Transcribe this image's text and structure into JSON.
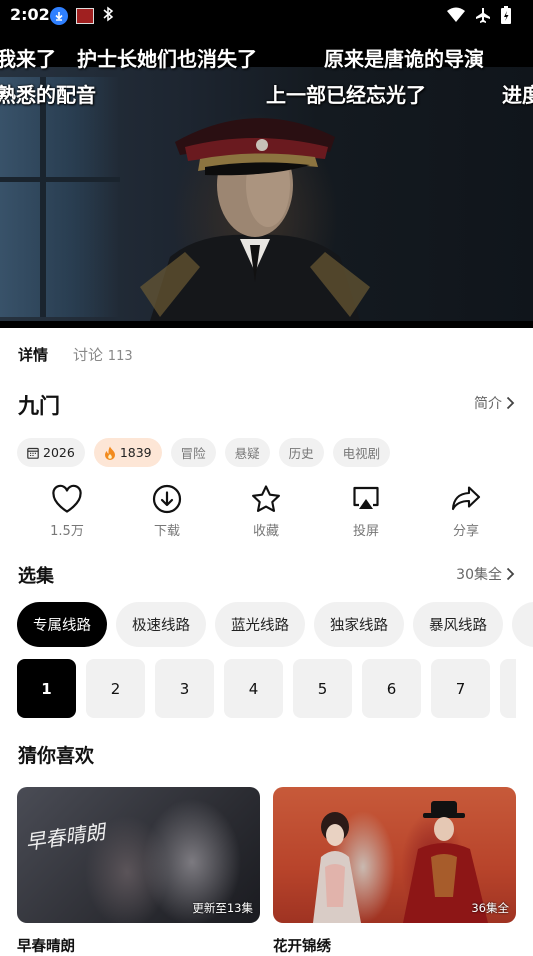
{
  "status_bar": {
    "time": "2:02",
    "icons": [
      "download-notification-icon",
      "app-notification-icon",
      "bluetooth-icon",
      "wifi-icon",
      "airplane-mode-icon",
      "battery-charging-icon"
    ]
  },
  "player": {
    "danmaku": [
      "我来了",
      "护士长她们也消失了",
      "原来是唐诡的导演",
      "熟悉的配音",
      "上一部已经忘光了",
      "进度"
    ]
  },
  "tabs": {
    "details": "详情",
    "discussion": "讨论",
    "discussion_count": "113"
  },
  "show": {
    "title": "九门",
    "intro_label": "简介",
    "year": "2026",
    "heat": "1839",
    "tags": [
      "冒险",
      "悬疑",
      "历史",
      "电视剧"
    ]
  },
  "actions": [
    {
      "label": "1.5万",
      "icon": "heart-icon"
    },
    {
      "label": "下载",
      "icon": "download-icon"
    },
    {
      "label": "收藏",
      "icon": "star-icon"
    },
    {
      "label": "投屏",
      "icon": "cast-icon"
    },
    {
      "label": "分享",
      "icon": "share-icon"
    }
  ],
  "episodes": {
    "section_title": "选集",
    "total_label": "30集全",
    "lines": [
      "专属线路",
      "极速线路",
      "蓝光线路",
      "独家线路",
      "暴风线路"
    ],
    "numbers": [
      "1",
      "2",
      "3",
      "4",
      "5",
      "6",
      "7"
    ]
  },
  "recommend": {
    "section_title": "猜你喜欢",
    "items": [
      {
        "title": "早春晴朗",
        "badge": "更新至13集",
        "cover_text": "早春晴朗"
      },
      {
        "title": "花开锦绣",
        "badge": "36集全"
      }
    ]
  },
  "colors": {
    "accent": "#000000",
    "chip_bg": "#f1f1f1",
    "heat_bg": "#fde6d6",
    "heat_icon": "#f28a1e"
  }
}
